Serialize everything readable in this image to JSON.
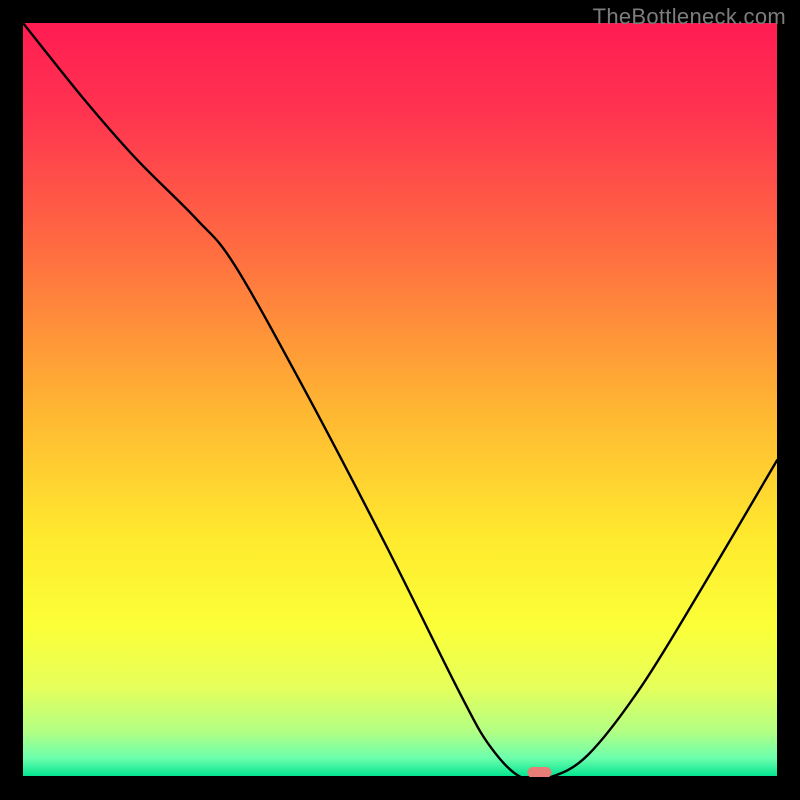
{
  "watermark": "TheBottleneck.com",
  "chart_data": {
    "type": "line",
    "title": "",
    "xlabel": "",
    "ylabel": "",
    "xlim": [
      0,
      100
    ],
    "ylim": [
      0,
      100
    ],
    "series": [
      {
        "name": "bottleneck-curve",
        "x": [
          0,
          8,
          15,
          23,
          28,
          37,
          48,
          58,
          62,
          66,
          70,
          75,
          82,
          90,
          100
        ],
        "values": [
          100,
          90,
          82,
          74,
          68,
          52,
          31,
          11,
          4,
          0,
          0,
          3,
          12,
          25,
          42
        ]
      }
    ],
    "marker": {
      "x": 68.5,
      "y": 0.2,
      "color": "#e87d78"
    },
    "background_gradient": {
      "type": "vertical",
      "stops": [
        {
          "pos": 0.0,
          "color": "#ff1c52"
        },
        {
          "pos": 0.12,
          "color": "#ff3450"
        },
        {
          "pos": 0.3,
          "color": "#ff6c41"
        },
        {
          "pos": 0.5,
          "color": "#ffb233"
        },
        {
          "pos": 0.68,
          "color": "#ffe92e"
        },
        {
          "pos": 0.8,
          "color": "#fbff38"
        },
        {
          "pos": 0.88,
          "color": "#e6ff5a"
        },
        {
          "pos": 0.94,
          "color": "#b2ff84"
        },
        {
          "pos": 0.975,
          "color": "#6cffad"
        },
        {
          "pos": 1.0,
          "color": "#00e38e"
        }
      ]
    }
  }
}
